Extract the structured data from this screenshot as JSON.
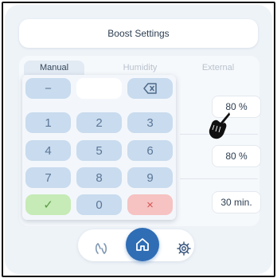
{
  "header": {
    "title": "Boost Settings"
  },
  "tabs": [
    {
      "label": "Manual",
      "active": true
    },
    {
      "label": "Humidity",
      "active": false
    },
    {
      "label": "External",
      "active": false
    }
  ],
  "values": [
    {
      "text": "80 %"
    },
    {
      "text": "80 %"
    },
    {
      "text": "30 min."
    }
  ],
  "keypad": {
    "minus": "−",
    "digits": [
      "1",
      "2",
      "3",
      "4",
      "5",
      "6",
      "7",
      "8",
      "9",
      "0"
    ],
    "ok": "✓",
    "cancel": "×",
    "backspace_icon": "backspace-icon"
  },
  "nav": {
    "left_icon": "fan-icon",
    "center_icon": "home-icon",
    "right_icon": "gear-icon"
  },
  "colors": {
    "accent": "#2f6db5",
    "key": "#c9dbee",
    "ok": "#c6ebb6",
    "cancel": "#f6c2c2"
  }
}
